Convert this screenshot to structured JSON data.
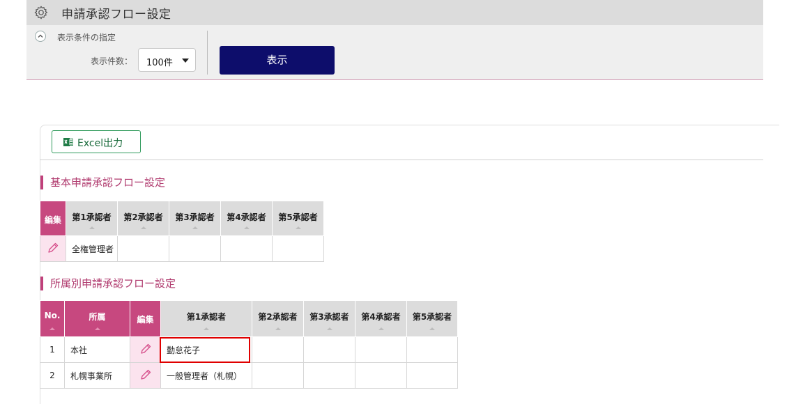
{
  "header": {
    "title": "申請承認フロー設定",
    "icon": "gear-icon"
  },
  "filter": {
    "caption": "表示条件の指定",
    "count_label": "表示件数：",
    "count_value": "100件",
    "show_button": "表示"
  },
  "toolbar": {
    "excel_button": "Excel出力"
  },
  "basic_section": {
    "title": "基本申請承認フロー設定",
    "columns": [
      "編集",
      "第1承認者",
      "第2承認者",
      "第3承認者",
      "第4承認者",
      "第5承認者"
    ],
    "rows": [
      {
        "approver1": "全権管理者",
        "approver2": "",
        "approver3": "",
        "approver4": "",
        "approver5": ""
      }
    ]
  },
  "dept_section": {
    "title": "所属別申請承認フロー設定",
    "columns": [
      "No.",
      "所属",
      "編集",
      "第1承認者",
      "第2承認者",
      "第3承認者",
      "第4承認者",
      "第5承認者"
    ],
    "rows": [
      {
        "no": "1",
        "dept": "本社",
        "approver1": "勤怠花子",
        "approver2": "",
        "approver3": "",
        "approver4": "",
        "approver5": ""
      },
      {
        "no": "2",
        "dept": "札幌事業所",
        "approver1": "一般管理者（札幌）",
        "approver2": "",
        "approver3": "",
        "approver4": "",
        "approver5": ""
      }
    ]
  },
  "colors": {
    "accent_pink": "#c7487f",
    "edit_cell_bg": "#fbe3ee",
    "primary_button": "#0d0d6b",
    "excel_green": "#2f9a5b",
    "highlight_red": "#e00000"
  }
}
